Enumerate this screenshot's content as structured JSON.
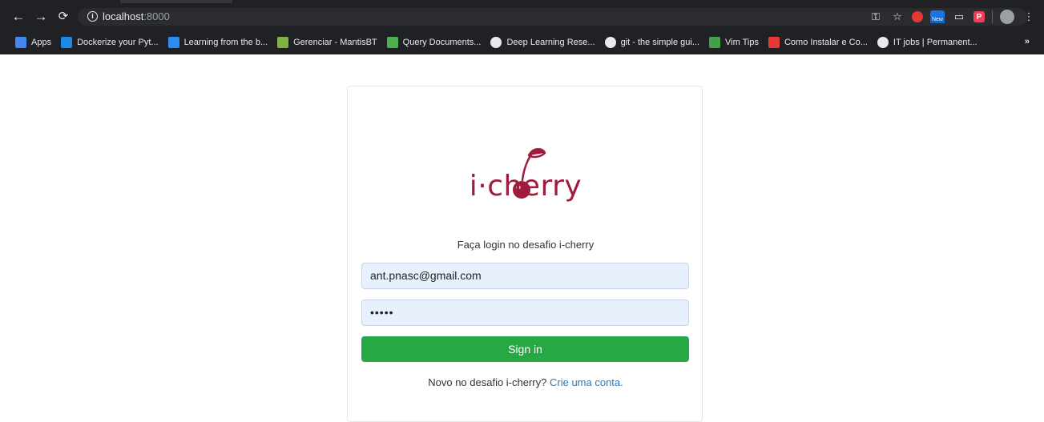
{
  "browser": {
    "url_host": "localhost",
    "url_port": ":8000",
    "bookmarks": [
      {
        "label": "Apps",
        "icon": "apps-grid-icon",
        "color": "#4285f4"
      },
      {
        "label": "Dockerize your Pyt...",
        "icon": "dockerize-icon",
        "color": "#1e88e5"
      },
      {
        "label": "Learning from the b...",
        "icon": "k-icon",
        "color": "#2d8cf0"
      },
      {
        "label": "Gerenciar - MantisBT",
        "icon": "mantis-icon",
        "color": "#7cb342"
      },
      {
        "label": "Query Documents...",
        "icon": "mongodb-leaf-icon",
        "color": "#4caf50"
      },
      {
        "label": "Deep Learning Rese...",
        "icon": "github-icon",
        "color": "#e8eaed"
      },
      {
        "label": "git - the simple gui...",
        "icon": "github-icon",
        "color": "#e8eaed"
      },
      {
        "label": "Vim Tips",
        "icon": "vim-icon",
        "color": "#43a047"
      },
      {
        "label": "Como Instalar e Co...",
        "icon": "youtube-icon",
        "color": "#e53935"
      },
      {
        "label": "IT jobs | Permanent...",
        "icon": "jobs-icon",
        "color": "#e8eaed"
      }
    ],
    "more": "»",
    "new_badge": "New",
    "pocket_glyph": "P"
  },
  "login": {
    "logo_text": "i·cherry",
    "subtitle": "Faça login no desafio i-cherry",
    "email_value": "ant.pnasc@gmail.com",
    "password_value": "•••••",
    "signin_label": "Sign in",
    "signup_prefix": "Novo no desafio i-cherry?",
    "signup_link": "Crie uma conta."
  },
  "colors": {
    "brand": "#a01c3d",
    "button": "#28a745",
    "link": "#2a7ac2",
    "autofill": "#e8f0fe"
  }
}
